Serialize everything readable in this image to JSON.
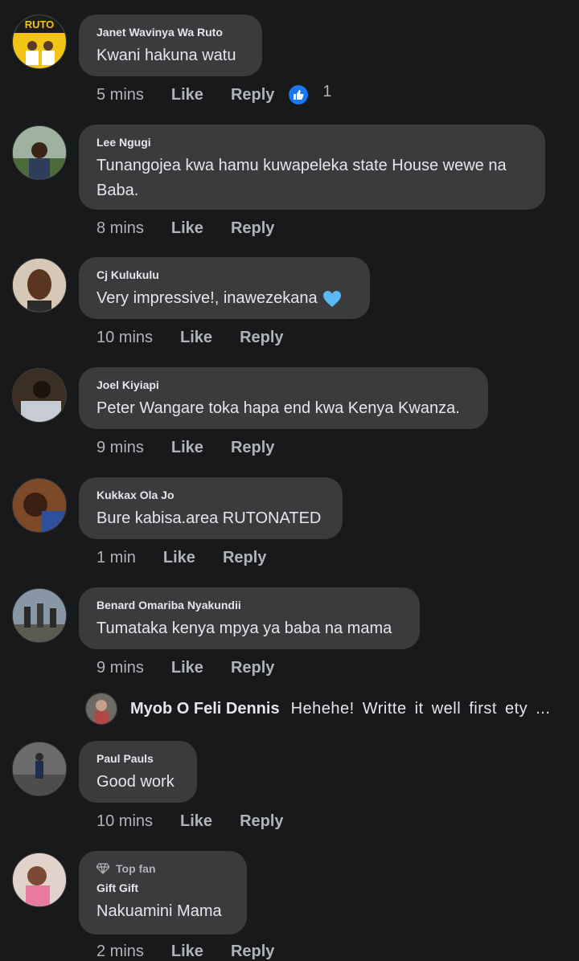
{
  "colors": {
    "background": "#18191a",
    "bubble": "#3a3b3c",
    "like_blue": "#1877f2",
    "heart_blue": "#5cb8f5"
  },
  "comments": [
    {
      "name": "Janet Wavinya Wa Ruto",
      "text": "Kwani hakuna watu",
      "time": "5 mins",
      "like": "Like",
      "reply": "Reply",
      "reaction_icon": "like-reaction-icon",
      "reaction_count": "1",
      "avatar_label": "RUTO"
    },
    {
      "name": "Lee Ngugi",
      "text_line1": "Tunangojea kwa hamu kuwapeleka state House wewe na",
      "text_line2": "Baba.",
      "time": "8 mins",
      "like": "Like",
      "reply": "Reply"
    },
    {
      "name": "Cj Kulukulu",
      "text": "Very impressive!, inawezekana",
      "emoji": "blue-heart-icon",
      "time": "10 mins",
      "like": "Like",
      "reply": "Reply"
    },
    {
      "name": "Joel Kiyiapi",
      "text": "Peter Wangare toka hapa end kwa Kenya Kwanza.",
      "time": "9 mins",
      "like": "Like",
      "reply": "Reply"
    },
    {
      "name": "Kukkax Ola Jo",
      "text": "Bure kabisa.area RUTONATED",
      "time": "1 min",
      "like": "Like",
      "reply": "Reply"
    },
    {
      "name": "Benard Omariba Nyakundii",
      "text": "Tumataka kenya mpya ya baba na mama",
      "time": "9 mins",
      "like": "Like",
      "reply": "Reply"
    },
    {
      "name": "Paul Pauls",
      "text": "Good work",
      "time": "10 mins",
      "like": "Like",
      "reply": "Reply"
    },
    {
      "name": "Gift Gift",
      "badge": "Top fan",
      "text": "Nakuamini Mama",
      "time": "2 mins",
      "like": "Like",
      "reply": "Reply"
    }
  ],
  "reply_preview": {
    "name": "Myob O Feli Dennis",
    "text": "Hehehe! Writte it well first ety ..."
  }
}
